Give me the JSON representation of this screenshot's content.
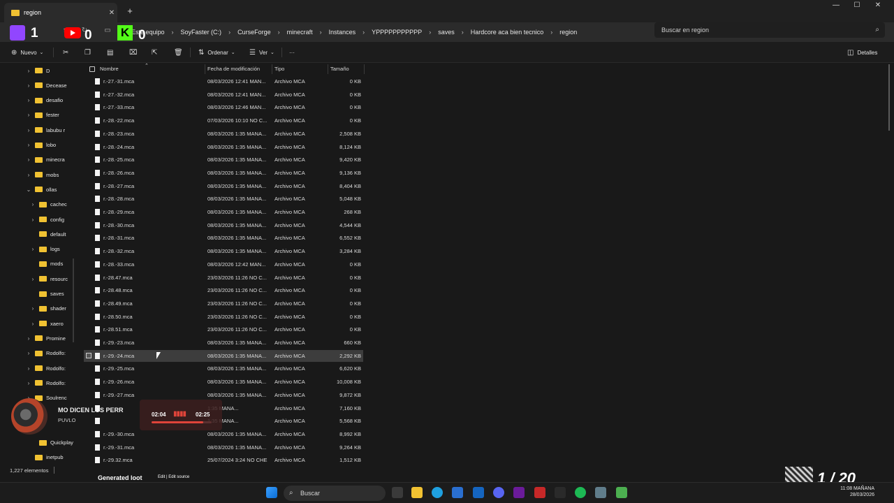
{
  "tab": {
    "title": "region",
    "close": "✕",
    "new": "+"
  },
  "window": {
    "minimize": "—",
    "maximize": "☐",
    "close": "✕"
  },
  "overlay": {
    "twitch_count": "1",
    "youtube_count": "0",
    "kick_letter": "K",
    "kick_count": "0"
  },
  "breadcrumbs": [
    "Este equipo",
    "SoyFaster (C:)",
    "CurseForge",
    "minecraft",
    "Instances",
    "YPPPPPPPPPPP",
    "saves",
    "Hardcore aca bien tecnico",
    "region"
  ],
  "search": {
    "placeholder": "Buscar en region"
  },
  "toolbar": {
    "new": "Nuevo",
    "sort": "Ordenar",
    "view": "Ver",
    "more": "···",
    "details": "Detalles"
  },
  "sidebar": {
    "items": [
      {
        "label": "D",
        "level": 0,
        "expanded": false
      },
      {
        "label": "Decease",
        "level": 0,
        "expanded": false
      },
      {
        "label": "desafio",
        "level": 0,
        "expanded": false
      },
      {
        "label": "fester",
        "level": 0,
        "expanded": false
      },
      {
        "label": "labubu r",
        "level": 0,
        "expanded": false
      },
      {
        "label": "lobo",
        "level": 0,
        "expanded": false
      },
      {
        "label": "minecra",
        "level": 0,
        "expanded": false
      },
      {
        "label": "mobs",
        "level": 0,
        "expanded": false
      },
      {
        "label": "ollas",
        "level": 0,
        "expanded": true
      },
      {
        "label": "cachec",
        "level": 1,
        "expanded": false
      },
      {
        "label": "config",
        "level": 1,
        "expanded": false
      },
      {
        "label": "default",
        "level": 1,
        "expanded": null
      },
      {
        "label": "logs",
        "level": 1,
        "expanded": false
      },
      {
        "label": "mods",
        "level": 1,
        "expanded": null
      },
      {
        "label": "resourc",
        "level": 1,
        "expanded": false
      },
      {
        "label": "saves",
        "level": 1,
        "expanded": null
      },
      {
        "label": "shader",
        "level": 1,
        "expanded": false
      },
      {
        "label": "xaero",
        "level": 1,
        "expanded": false
      },
      {
        "label": "Promine",
        "level": 0,
        "expanded": false
      },
      {
        "label": "Rodolfo:",
        "level": 0,
        "expanded": false
      },
      {
        "label": "Rodolfo:",
        "level": 0,
        "expanded": false
      },
      {
        "label": "Rodolfo:",
        "level": 0,
        "expanded": false
      },
      {
        "label": "Soulrenc",
        "level": 0,
        "expanded": false
      },
      {
        "label": "",
        "level": 0,
        "expanded": null
      },
      {
        "label": "",
        "level": 0,
        "expanded": null
      },
      {
        "label": "Quickplay",
        "level": 1,
        "expanded": null
      },
      {
        "label": "inetpub",
        "level": 0,
        "expanded": null
      }
    ]
  },
  "columns": {
    "name": "Nombre",
    "modified": "Fecha de modificación",
    "type": "Tipo",
    "size": "Tamaño"
  },
  "files": [
    {
      "name": "r.-27.-31.mca",
      "date": "08/03/2026 12:41 MAN...",
      "type": "Archivo MCA",
      "size": "0 KB"
    },
    {
      "name": "r.-27.-32.mca",
      "date": "08/03/2026 12:41 MAN...",
      "type": "Archivo MCA",
      "size": "0 KB"
    },
    {
      "name": "r.-27.-33.mca",
      "date": "08/03/2026 12:46 MAN...",
      "type": "Archivo MCA",
      "size": "0 KB"
    },
    {
      "name": "r.-28.-22.mca",
      "date": "07/03/2026 10:10 NO C...",
      "type": "Archivo MCA",
      "size": "0 KB"
    },
    {
      "name": "r.-28.-23.mca",
      "date": "08/03/2026 1:35 MANA...",
      "type": "Archivo MCA",
      "size": "2,508 KB"
    },
    {
      "name": "r.-28.-24.mca",
      "date": "08/03/2026 1:35 MANA...",
      "type": "Archivo MCA",
      "size": "8,124 KB"
    },
    {
      "name": "r.-28.-25.mca",
      "date": "08/03/2026 1:35 MANA...",
      "type": "Archivo MCA",
      "size": "9,420 KB"
    },
    {
      "name": "r.-28.-26.mca",
      "date": "08/03/2026 1:35 MANA...",
      "type": "Archivo MCA",
      "size": "9,136 KB"
    },
    {
      "name": "r.-28.-27.mca",
      "date": "08/03/2026 1:35 MANA...",
      "type": "Archivo MCA",
      "size": "8,404 KB"
    },
    {
      "name": "r.-28.-28.mca",
      "date": "08/03/2026 1:35 MANA...",
      "type": "Archivo MCA",
      "size": "5,048 KB"
    },
    {
      "name": "r.-28.-29.mca",
      "date": "08/03/2026 1:35 MANA...",
      "type": "Archivo MCA",
      "size": "268 KB"
    },
    {
      "name": "r.-28.-30.mca",
      "date": "08/03/2026 1:35 MANA...",
      "type": "Archivo MCA",
      "size": "4,544 KB"
    },
    {
      "name": "r.-28.-31.mca",
      "date": "08/03/2026 1:35 MANA...",
      "type": "Archivo MCA",
      "size": "6,552 KB"
    },
    {
      "name": "r.-28.-32.mca",
      "date": "08/03/2026 1:35 MANA...",
      "type": "Archivo MCA",
      "size": "3,284 KB"
    },
    {
      "name": "r.-28.-33.mca",
      "date": "08/03/2026 12:42 MAN...",
      "type": "Archivo MCA",
      "size": "0 KB"
    },
    {
      "name": "r.-28.47.mca",
      "date": "23/03/2026 11:26 NO C...",
      "type": "Archivo MCA",
      "size": "0 KB"
    },
    {
      "name": "r.-28.48.mca",
      "date": "23/03/2026 11:26 NO C...",
      "type": "Archivo MCA",
      "size": "0 KB"
    },
    {
      "name": "r.-28.49.mca",
      "date": "23/03/2026 11:26 NO C...",
      "type": "Archivo MCA",
      "size": "0 KB"
    },
    {
      "name": "r.-28.50.mca",
      "date": "23/03/2026 11:26 NO C...",
      "type": "Archivo MCA",
      "size": "0 KB"
    },
    {
      "name": "r.-28.51.mca",
      "date": "23/03/2026 11:26 NO C...",
      "type": "Archivo MCA",
      "size": "0 KB"
    },
    {
      "name": "r.-29.-23.mca",
      "date": "08/03/2026 1:35 MANA...",
      "type": "Archivo MCA",
      "size": "660 KB"
    },
    {
      "name": "r.-29.-24.mca",
      "date": "08/03/2026 1:35 MANA...",
      "type": "Archivo MCA",
      "size": "2,292 KB",
      "selected": true
    },
    {
      "name": "r.-29.-25.mca",
      "date": "08/03/2026 1:35 MANA...",
      "type": "Archivo MCA",
      "size": "6,620 KB"
    },
    {
      "name": "r.-29.-26.mca",
      "date": "08/03/2026 1:35 MANA...",
      "type": "Archivo MCA",
      "size": "10,008 KB"
    },
    {
      "name": "r.-29.-27.mca",
      "date": "08/03/2026 1:35 MANA...",
      "type": "Archivo MCA",
      "size": "9,872 KB"
    },
    {
      "name": "",
      "date": "1:35 MANA...",
      "type": "Archivo MCA",
      "size": "7,160 KB"
    },
    {
      "name": "",
      "date": "1:35 MANA...",
      "type": "Archivo MCA",
      "size": "5,568 KB"
    },
    {
      "name": "r.-29.-30.mca",
      "date": "08/03/2026 1:35 MANA...",
      "type": "Archivo MCA",
      "size": "8,992 KB"
    },
    {
      "name": "r.-29.-31.mca",
      "date": "08/03/2026 1:35 MANA...",
      "type": "Archivo MCA",
      "size": "9,264 KB"
    },
    {
      "name": "r.-29.32.mca",
      "date": "25/07/2024 3:24 NO CHE",
      "type": "Archivo MCA",
      "size": "1,512 KB"
    }
  ],
  "status": {
    "count": "1,227 elementos",
    "behind_text": "Generated loot",
    "behind_small": "Edit | Edit source"
  },
  "music": {
    "song": "MO DICEN LOS PERR",
    "artist": "PUVLO",
    "elapsed": "02:04",
    "total": "02:25",
    "progress": 0.855
  },
  "taskbar": {
    "search": "Buscar",
    "time": "11:08 MAÑANA",
    "date": "28/03/2026"
  },
  "counter": "1 / 20"
}
